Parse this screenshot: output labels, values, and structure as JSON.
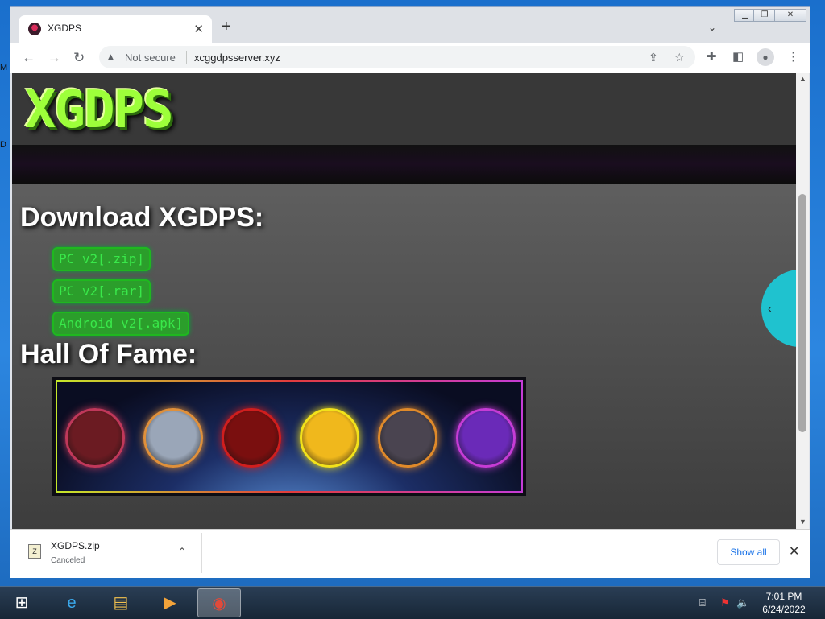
{
  "desktop": {
    "side_letters": "M\n\nD"
  },
  "window": {
    "controls": {
      "minimize": "▁",
      "restore": "❐",
      "close": "✕"
    }
  },
  "tab": {
    "title": "XGDPS",
    "close": "✕",
    "new_tab": "+",
    "tab_search": "⌄"
  },
  "toolbar": {
    "back": "←",
    "forward": "→",
    "reload": "↻",
    "security_icon": "▲",
    "security_label": "Not secure",
    "url": "xcggdpsserver.xyz",
    "share_icon": "⇪",
    "bookmark_icon": "☆",
    "extensions_icon": "✚",
    "sidepanel_icon": "◧",
    "profile_icon": "●",
    "menu_icon": "⋮"
  },
  "page": {
    "logo": "XGDPS",
    "download_heading": "Download XGDPS:",
    "downloads": [
      {
        "label": "PC v2[.zip]"
      },
      {
        "label": "PC v2[.rar]"
      },
      {
        "label": "Android v2[.apk]"
      }
    ],
    "hof_heading": "Hall Of Fame:",
    "hall_of_fame": [
      {
        "icon": "witch-girl-avatar",
        "ring": "#c0385a",
        "fill": "#6b1b22"
      },
      {
        "icon": "glasses-boy-avatar",
        "ring": "#e0903a",
        "fill": "#9aa6b8"
      },
      {
        "icon": "red-demon-avatar",
        "ring": "#d01e1e",
        "fill": "#7a0f0f"
      },
      {
        "icon": "yellow-cat-avatar",
        "ring": "#f2e21a",
        "fill": "#f0b81c"
      },
      {
        "icon": "orange-cat-avatar",
        "ring": "#e08a2a",
        "fill": "#4a4450"
      },
      {
        "icon": "purple-skull-avatar",
        "ring": "#c63cd6",
        "fill": "#6a2ab8"
      }
    ],
    "side_toggle": "‹"
  },
  "scrollbar": {
    "up": "▲",
    "down": "▼"
  },
  "download_shelf": {
    "file_name": "XGDPS.zip",
    "status": "Canceled",
    "file_icon": "Z",
    "chevron": "⌃",
    "show_all": "Show all",
    "close": "✕"
  },
  "taskbar": {
    "start_icon": "⊞",
    "apps": [
      {
        "icon": "e",
        "color": "#3aa8ea"
      },
      {
        "icon": "▤",
        "color": "#f2c14e"
      },
      {
        "icon": "▶",
        "color": "#f2a33a"
      },
      {
        "icon": "◉",
        "color": "#e24a3a"
      }
    ],
    "tray": {
      "network": "⌸",
      "flag": "⚑",
      "volume": "🔈"
    },
    "time": "7:01 PM",
    "date": "6/24/2022"
  },
  "colors": {
    "accent_green": "#39e84a",
    "side_toggle": "#1fc2cf",
    "show_all_blue": "#1a73e8"
  }
}
